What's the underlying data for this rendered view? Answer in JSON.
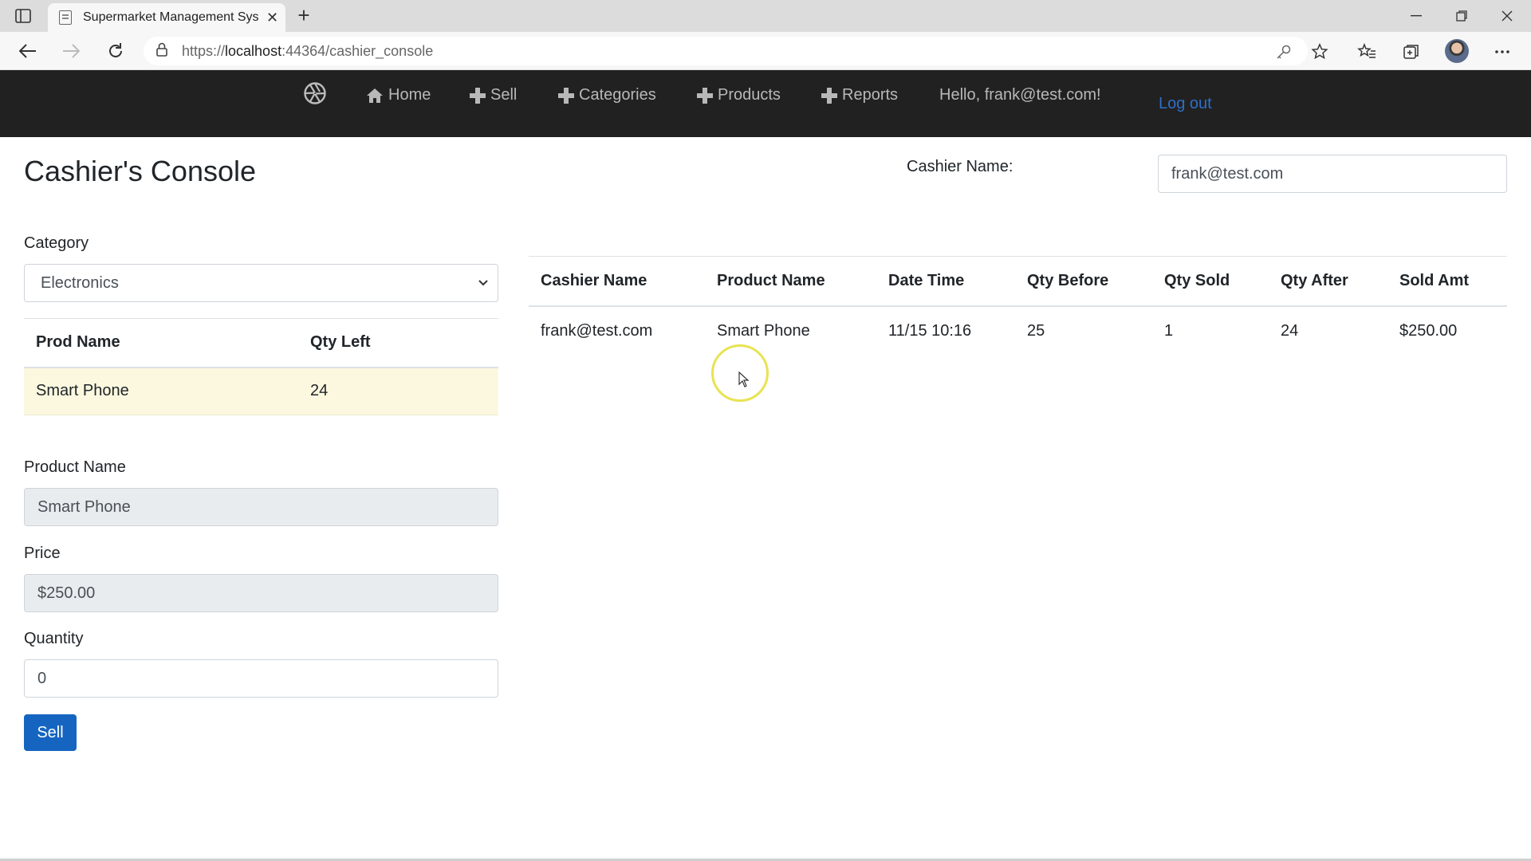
{
  "browser": {
    "tab_title": "Supermarket Management Syste",
    "tab_close": "✕",
    "new_tab": "+",
    "url_prefix": "https://",
    "url_host": "localhost",
    "url_path": ":44364/cashier_console"
  },
  "navbar": {
    "items": [
      {
        "icon": "home-icon",
        "label": "Home"
      },
      {
        "icon": "plus-icon",
        "label": "Sell"
      },
      {
        "icon": "plus-icon",
        "label": "Categories"
      },
      {
        "icon": "plus-icon",
        "label": "Products"
      },
      {
        "icon": "plus-icon",
        "label": "Reports"
      }
    ],
    "greeting": "Hello, frank@test.com!",
    "logout": "Log out"
  },
  "page": {
    "title": "Cashier's Console",
    "cashier_label": "Cashier Name:",
    "cashier_value": "frank@test.com"
  },
  "category": {
    "label": "Category",
    "selected": "Electronics"
  },
  "products_table": {
    "headers": [
      "Prod Name",
      "Qty Left"
    ],
    "rows": [
      [
        "Smart Phone",
        "24"
      ]
    ]
  },
  "form": {
    "product_name_label": "Product Name",
    "product_name_value": "Smart Phone",
    "price_label": "Price",
    "price_value": "$250.00",
    "quantity_label": "Quantity",
    "quantity_value": "0",
    "sell_button": "Sell"
  },
  "transactions_table": {
    "headers": [
      "Cashier Name",
      "Product Name",
      "Date Time",
      "Qty Before",
      "Qty Sold",
      "Qty After",
      "Sold Amt"
    ],
    "rows": [
      [
        "frank@test.com",
        "Smart Phone",
        "11/15 10:16",
        "25",
        "1",
        "24",
        "$250.00"
      ]
    ]
  },
  "colors": {
    "navbar_bg": "#212121",
    "accent": "#1565c0",
    "selected_row": "#fbf8df"
  }
}
